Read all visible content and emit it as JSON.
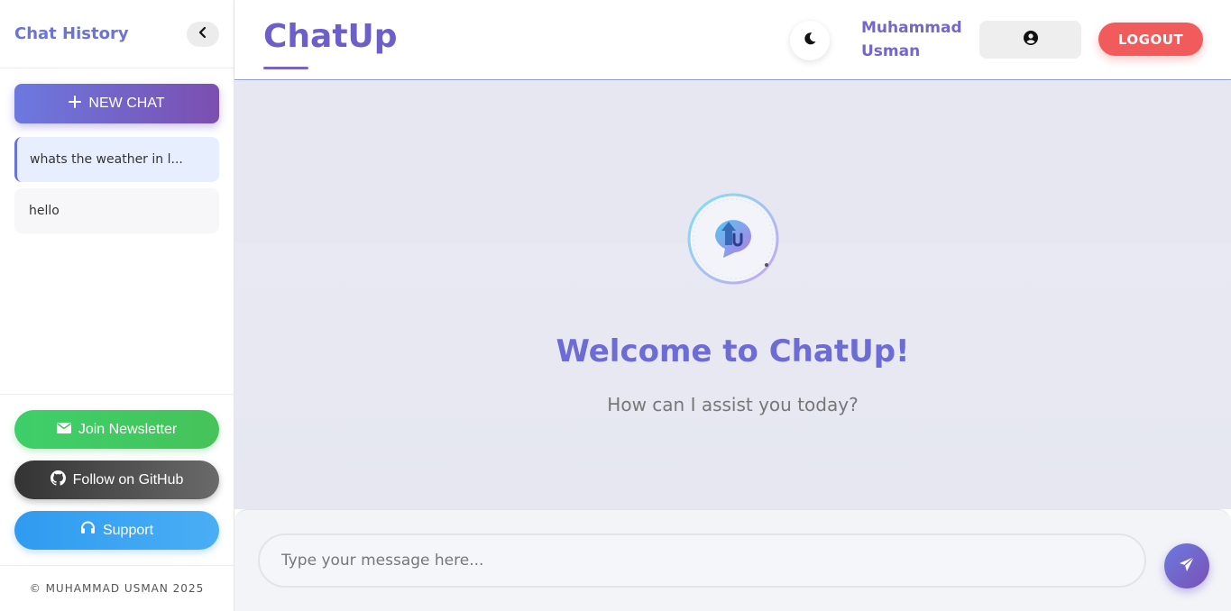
{
  "sidebar": {
    "title": "Chat History",
    "new_chat_label": "NEW CHAT",
    "history": [
      {
        "label": "whats the weather in l..."
      },
      {
        "label": "hello"
      }
    ],
    "newsletter_label": "Join Newsletter",
    "github_label": "Follow on GitHub",
    "support_label": "Support",
    "copyright": "© MUHAMMAD USMAN 2025"
  },
  "header": {
    "brand": "ChatUp",
    "user_first": "Muhammad",
    "user_last": "Usman",
    "logout_label": "LOGOUT"
  },
  "main": {
    "welcome": "Welcome to ChatUp!",
    "subtitle": "How can I assist you today?"
  },
  "composer": {
    "placeholder": "Type your message here..."
  },
  "colors": {
    "accent": "#6a73d8",
    "accent_purple": "#7b4fb0",
    "logout": "#f25b5b",
    "newsletter": "#46c35a",
    "github": "#333333",
    "support": "#2f9bf0"
  },
  "icons": {
    "collapse": "chevron-left-icon",
    "new_chat": "plus-icon",
    "newsletter": "envelope-icon",
    "github": "github-icon",
    "support": "headset-icon",
    "theme": "moon-icon",
    "profile": "user-circle-icon",
    "send": "paper-plane-icon",
    "logo": "chatup-logo-icon"
  }
}
